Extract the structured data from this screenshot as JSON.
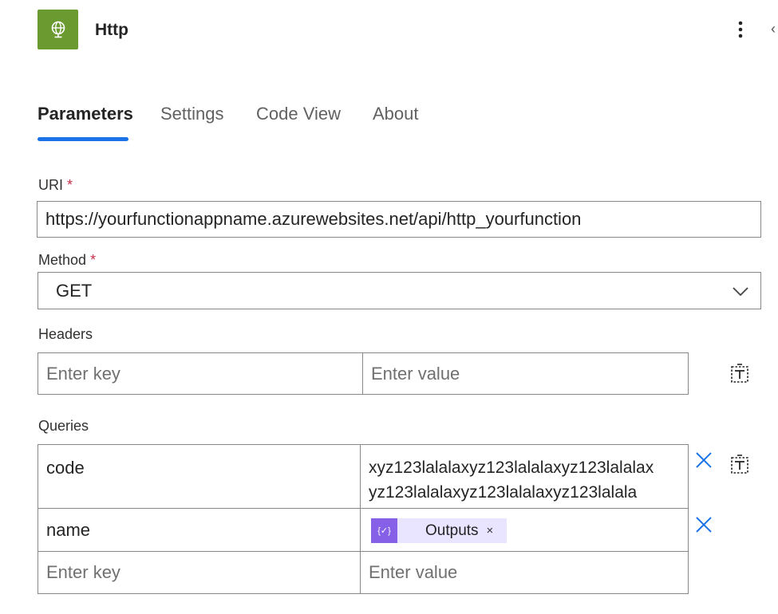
{
  "header": {
    "title": "Http",
    "icon": "globe-icon",
    "accent": "#6a9a30"
  },
  "tabs": [
    {
      "label": "Parameters",
      "active": true
    },
    {
      "label": "Settings",
      "active": false
    },
    {
      "label": "Code View",
      "active": false
    },
    {
      "label": "About",
      "active": false
    }
  ],
  "uri": {
    "label": "URI",
    "required_mark": "*",
    "value": "https://yourfunctionappname.azurewebsites.net/api/http_yourfunction"
  },
  "method": {
    "label": "Method",
    "required_mark": "*",
    "value": "GET"
  },
  "headers": {
    "label": "Headers",
    "key_placeholder": "Enter key",
    "value_placeholder": "Enter value"
  },
  "queries": {
    "label": "Queries",
    "rows": [
      {
        "key": "code",
        "value_line1": "xyz123lalalaxyz123lalalaxyz123lalalax",
        "value_line2": "yz123lalalaxyz123lalalaxyz123lalala"
      },
      {
        "key": "name",
        "token": {
          "label": "Outputs",
          "remove": "×",
          "icon_glyph": "{✓}"
        }
      }
    ],
    "key_placeholder": "Enter key",
    "value_placeholder": "Enter value"
  },
  "colors": {
    "tab_underline": "#1a73e8",
    "remove_icon": "#1a73e8",
    "token_bg": "#e9e4ff",
    "token_icon_bg": "#8661e8",
    "required": "#c4314b"
  }
}
